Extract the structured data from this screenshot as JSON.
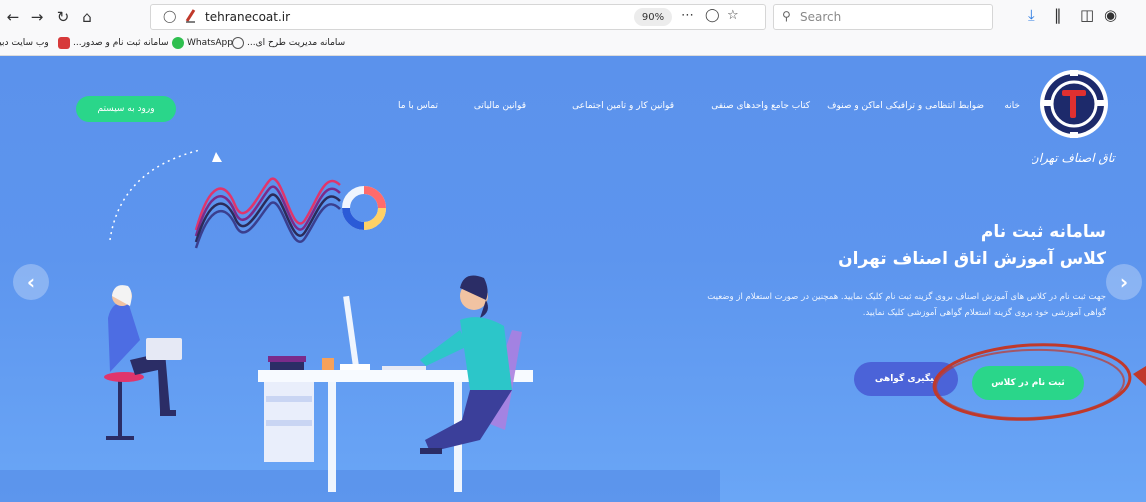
{
  "browser": {
    "url": "tehranecoat.ir",
    "zoom": "90%",
    "search_placeholder": "Search"
  },
  "bookmarks": [
    {
      "label": "سامانه مدیریت طرح ای...",
      "color": "#6c8ce0"
    },
    {
      "label": "WhatsApp",
      "color": "#2fbf4f"
    },
    {
      "label": "سامانه ثبت نام و صدور...",
      "color": "#d73a3a"
    },
    {
      "label": "وب سایت دبیرخانه هی...",
      "color": "#555555"
    }
  ],
  "site": {
    "logo_caption": "اتاق اصناف تهران",
    "nav": [
      "خانه",
      "ضوابط انتظامی و ترافیکی اماکن و صنوف",
      "کتاب جامع واحدهای صنفی",
      "قوانین کار و تامین اجتماعی",
      "قوانین مالیاتی",
      "تماس با ما"
    ],
    "login_label": "ورود به سیستم"
  },
  "hero": {
    "title_line1": "سامانه ثبت نام",
    "title_line2": "کلاس آموزش اتاق اصناف  تهران",
    "description": "جهت ثبت نام در کلاس های آموزش اصناف بروی گزینه ثبت نام کلیک نمایید. همچنین در صورت استعلام از وضعیت گواهی آموزشی خود بروی گزینه استعلام گواهی آموزشی کلیک نمایید.",
    "register_button": "ثبت نام در کلاس",
    "certificate_button": "پیگیری گواهی"
  },
  "colors": {
    "hero_bg": "#5d95ee",
    "accent_green": "#2ad68a",
    "button_blue": "#4b63d8",
    "annotation_red": "#c0392b"
  }
}
